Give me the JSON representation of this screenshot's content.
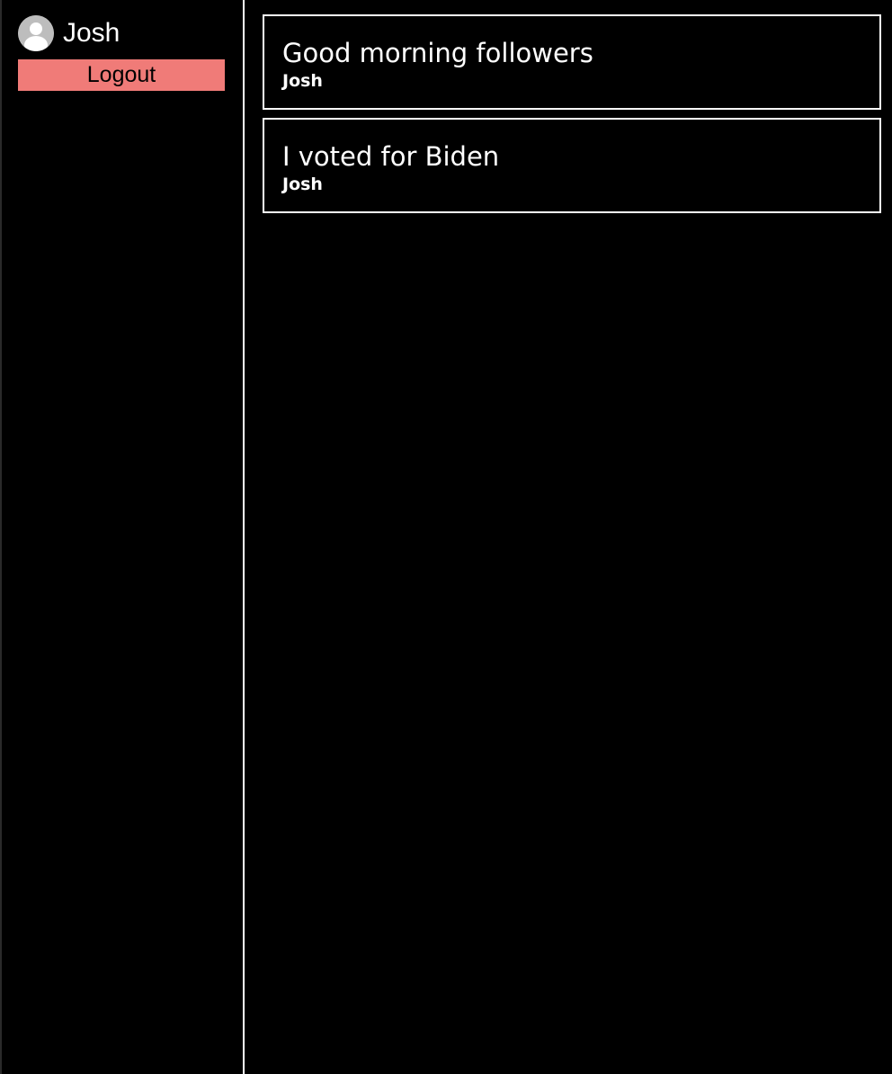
{
  "sidebar": {
    "user": {
      "name": "Josh",
      "avatar_icon": "user-avatar-icon"
    },
    "logout_label": "Logout"
  },
  "feed": {
    "posts": [
      {
        "text": "Good morning followers",
        "author": "Josh"
      },
      {
        "text": "I voted for Biden",
        "author": "Josh"
      }
    ]
  },
  "colors": {
    "background": "#000000",
    "logout_button": "#f07b78",
    "text": "#ffffff",
    "border": "#ffffff",
    "avatar": "#bdbdbd"
  }
}
